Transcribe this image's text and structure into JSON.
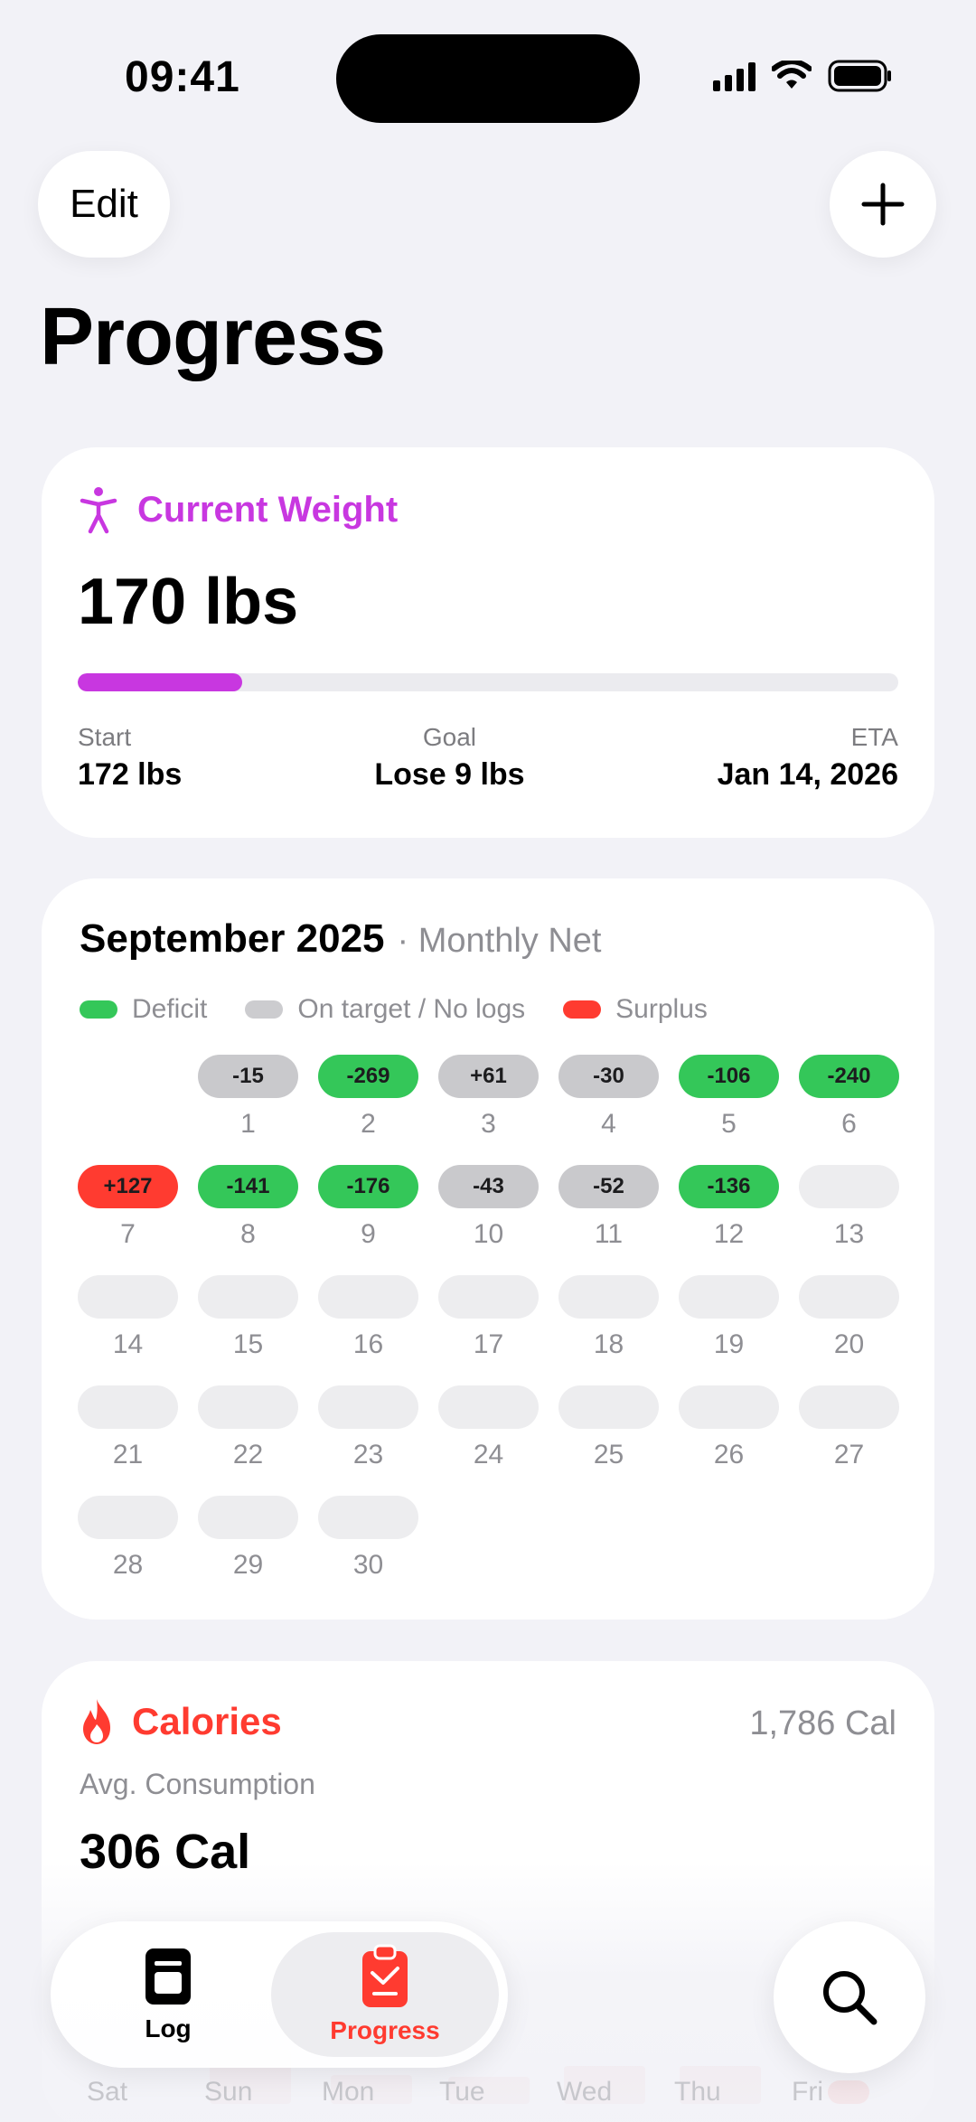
{
  "status": {
    "time": "09:41"
  },
  "header": {
    "edit_label": "Edit",
    "title": "Progress"
  },
  "weight": {
    "title": "Current Weight",
    "value": "170 lbs",
    "progress_fraction": 0.2,
    "start_label": "Start",
    "start_value": "172 lbs",
    "goal_label": "Goal",
    "goal_value": "Lose 9 lbs",
    "eta_label": "ETA",
    "eta_value": "Jan 14, 2026"
  },
  "calendar": {
    "month": "September 2025",
    "subtitle": "· Monthly Net",
    "legend": {
      "deficit": "Deficit",
      "on_target": "On target / No logs",
      "surplus": "Surplus"
    },
    "days": [
      {
        "day": "",
        "value": "",
        "kind": "blank"
      },
      {
        "day": "1",
        "value": "-15",
        "kind": "neutral"
      },
      {
        "day": "2",
        "value": "-269",
        "kind": "deficit"
      },
      {
        "day": "3",
        "value": "+61",
        "kind": "neutral"
      },
      {
        "day": "4",
        "value": "-30",
        "kind": "neutral"
      },
      {
        "day": "5",
        "value": "-106",
        "kind": "deficit"
      },
      {
        "day": "6",
        "value": "-240",
        "kind": "deficit"
      },
      {
        "day": "7",
        "value": "+127",
        "kind": "surplus"
      },
      {
        "day": "8",
        "value": "-141",
        "kind": "deficit"
      },
      {
        "day": "9",
        "value": "-176",
        "kind": "deficit"
      },
      {
        "day": "10",
        "value": "-43",
        "kind": "neutral"
      },
      {
        "day": "11",
        "value": "-52",
        "kind": "neutral"
      },
      {
        "day": "12",
        "value": "-136",
        "kind": "deficit"
      },
      {
        "day": "13",
        "value": "",
        "kind": "empty"
      },
      {
        "day": "14",
        "value": "",
        "kind": "empty"
      },
      {
        "day": "15",
        "value": "",
        "kind": "empty"
      },
      {
        "day": "16",
        "value": "",
        "kind": "empty"
      },
      {
        "day": "17",
        "value": "",
        "kind": "empty"
      },
      {
        "day": "18",
        "value": "",
        "kind": "empty"
      },
      {
        "day": "19",
        "value": "",
        "kind": "empty"
      },
      {
        "day": "20",
        "value": "",
        "kind": "empty"
      },
      {
        "day": "21",
        "value": "",
        "kind": "empty"
      },
      {
        "day": "22",
        "value": "",
        "kind": "empty"
      },
      {
        "day": "23",
        "value": "",
        "kind": "empty"
      },
      {
        "day": "24",
        "value": "",
        "kind": "empty"
      },
      {
        "day": "25",
        "value": "",
        "kind": "empty"
      },
      {
        "day": "26",
        "value": "",
        "kind": "empty"
      },
      {
        "day": "27",
        "value": "",
        "kind": "empty"
      },
      {
        "day": "28",
        "value": "",
        "kind": "empty"
      },
      {
        "day": "29",
        "value": "",
        "kind": "empty"
      },
      {
        "day": "30",
        "value": "",
        "kind": "empty"
      }
    ]
  },
  "calories": {
    "title": "Calories",
    "total": "1,786 Cal",
    "subtitle": "Avg. Consumption",
    "value": "306 Cal",
    "weekdays": [
      "Sat",
      "Sun",
      "Mon",
      "Tue",
      "Wed",
      "Thu",
      "Fri"
    ]
  },
  "tabbar": {
    "log_label": "Log",
    "progress_label": "Progress"
  },
  "colors": {
    "accent_weight": "#c837e0",
    "deficit": "#34c759",
    "surplus": "#ff3b30",
    "neutral": "#c9c9cc"
  },
  "icons": {
    "weight": "figure-icon",
    "calories": "flame-icon",
    "log": "notebook-icon",
    "progress": "clipboard-icon",
    "search": "search-icon",
    "add": "plus-icon"
  }
}
